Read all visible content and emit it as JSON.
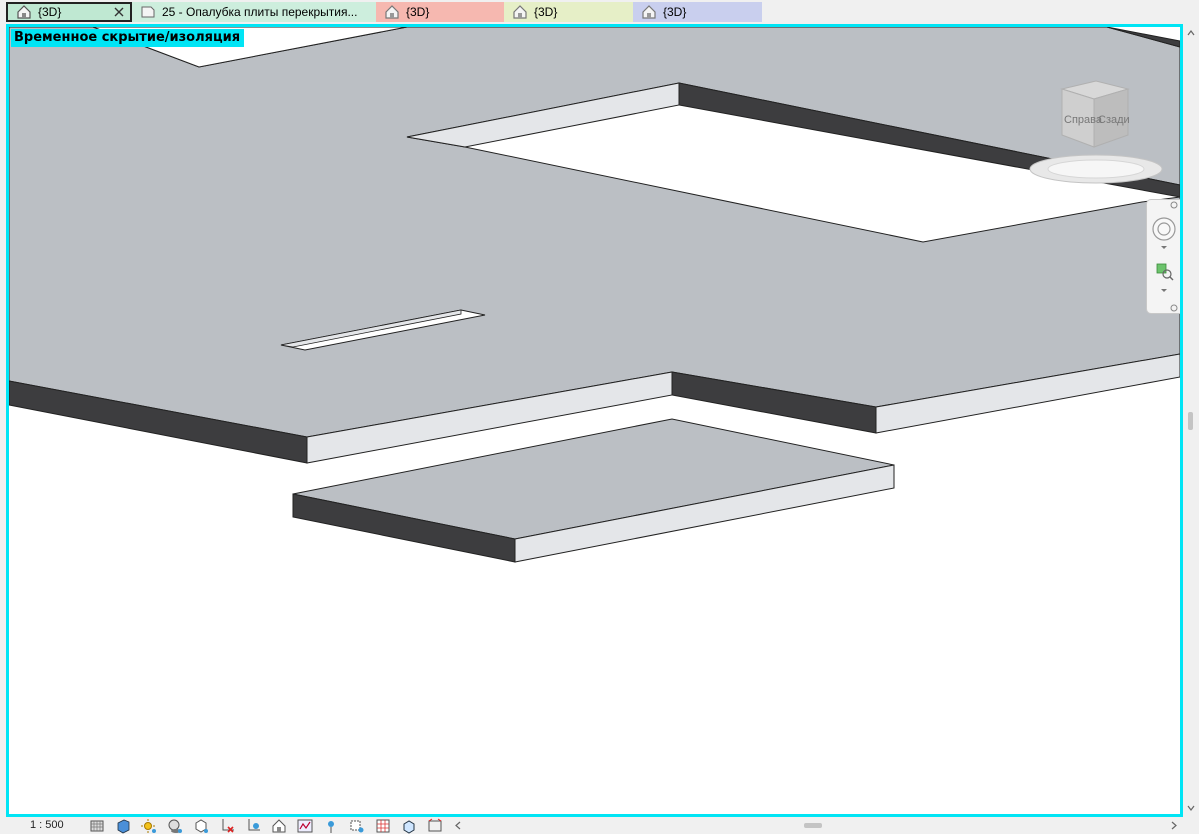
{
  "tabs": [
    {
      "label": "{3D}",
      "bg": "#bfe8d2",
      "active": true,
      "icon": "3d-house-icon"
    },
    {
      "label": "25 - Опалубка плиты перекрытия...",
      "bg": "#cdeedd",
      "active": false,
      "icon": "sheet-icon"
    },
    {
      "label": "{3D}",
      "bg": "#f6b8b0",
      "active": false,
      "icon": "3d-house-icon"
    },
    {
      "label": "{3D}",
      "bg": "#e6efc7",
      "active": false,
      "icon": "3d-house-icon"
    },
    {
      "label": "{3D}",
      "bg": "#c9cfee",
      "active": false,
      "icon": "3d-house-icon"
    }
  ],
  "viewport": {
    "isolate_label": "Временное скрытие/изоляция",
    "border_color": "#00e5f5"
  },
  "viewcube": {
    "right_face": "Справа",
    "back_face": "Сзади"
  },
  "statusbar": {
    "scale": "1 : 500",
    "icons": [
      "detail-level-icon",
      "visual-style-icon",
      "sun-path-icon",
      "shadows-icon",
      "crop-view-icon",
      "hide-crop-icon",
      "unlock-view-icon",
      "temporary-hide-icon",
      "reveal-hidden-icon",
      "analytical-model-icon",
      "highlight-icon",
      "worksharing-icon",
      "design-options-icon",
      "section-box-icon",
      "3d-view-icon"
    ]
  },
  "colors": {
    "slab_top": "#bbbfc4",
    "slab_front": "#e4e6e9",
    "slab_side": "#3d3d3f",
    "accent": "#00e5f5"
  }
}
